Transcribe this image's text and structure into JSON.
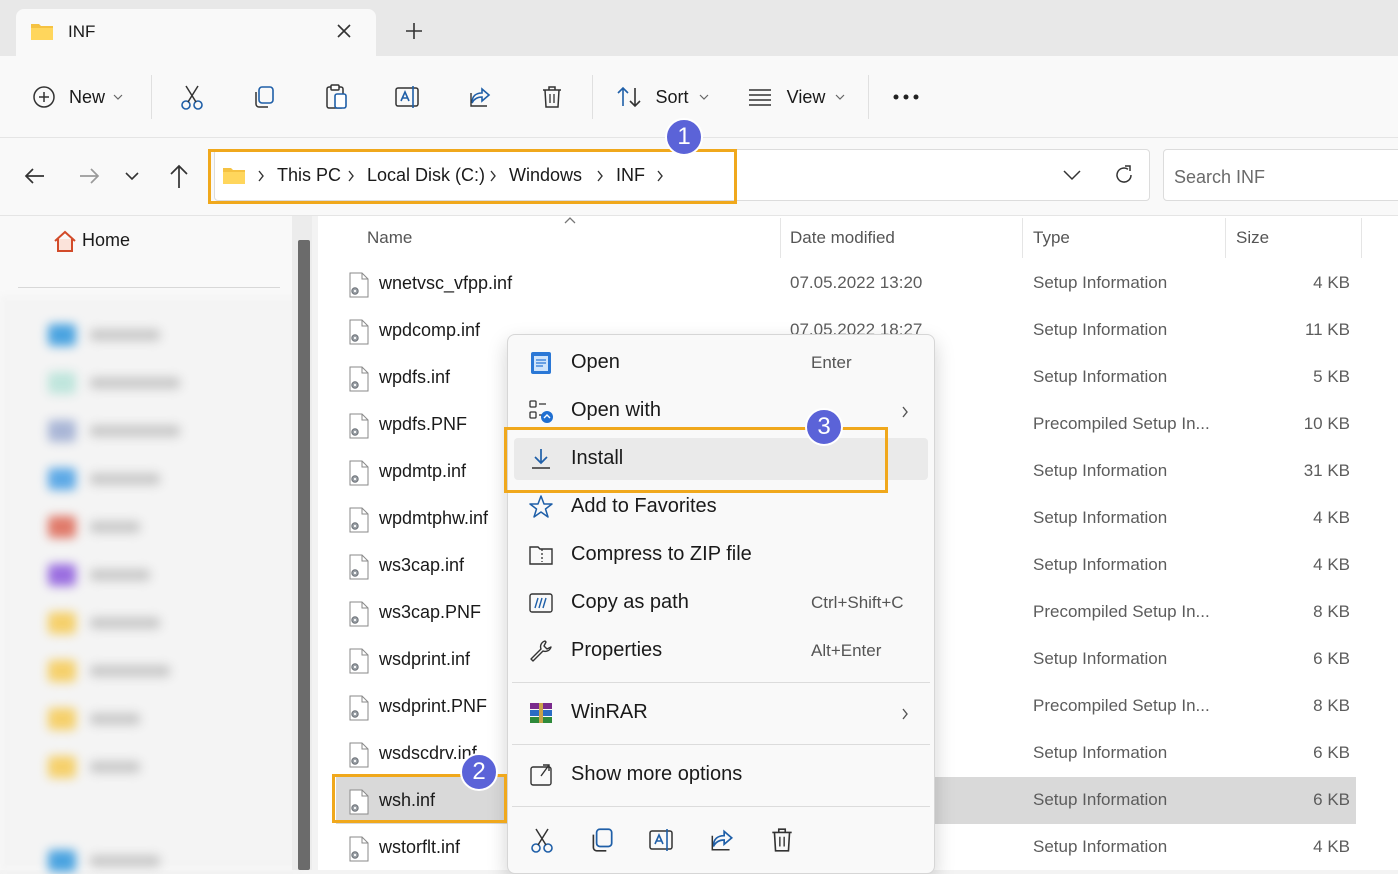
{
  "tab": {
    "title": "INF",
    "close_icon": "close-icon",
    "new_tab_icon": "plus-icon"
  },
  "command_bar": {
    "new_label": "New",
    "sort_label": "Sort",
    "view_label": "View",
    "icons": [
      "cut-icon",
      "copy-icon",
      "paste-icon",
      "rename-icon",
      "share-icon",
      "delete-icon",
      "more-icon"
    ]
  },
  "address": {
    "crumbs": [
      "This PC",
      "Local Disk (C:)",
      "Windows",
      "INF"
    ],
    "search_placeholder": "Search INF"
  },
  "sidebar": {
    "home_label": "Home"
  },
  "columns": {
    "name": "Name",
    "date": "Date modified",
    "type": "Type",
    "size": "Size"
  },
  "files": [
    {
      "name": "wnetvsc_vfpp.inf",
      "date": "07.05.2022 13:20",
      "type": "Setup Information",
      "size": "4 KB"
    },
    {
      "name": "wpdcomp.inf",
      "date": "07.05.2022 18:27",
      "type": "Setup Information",
      "size": "11 KB"
    },
    {
      "name": "wpdfs.inf",
      "date": "",
      "type": "Setup Information",
      "size": "5 KB"
    },
    {
      "name": "wpdfs.PNF",
      "date": "",
      "type": "Precompiled Setup In...",
      "size": "10 KB"
    },
    {
      "name": "wpdmtp.inf",
      "date": "",
      "type": "Setup Information",
      "size": "31 KB"
    },
    {
      "name": "wpdmtphw.inf",
      "date": "",
      "type": "Setup Information",
      "size": "4 KB"
    },
    {
      "name": "ws3cap.inf",
      "date": "",
      "type": "Setup Information",
      "size": "4 KB"
    },
    {
      "name": "ws3cap.PNF",
      "date": "",
      "type": "Precompiled Setup In...",
      "size": "8 KB"
    },
    {
      "name": "wsdprint.inf",
      "date": "",
      "type": "Setup Information",
      "size": "6 KB"
    },
    {
      "name": "wsdprint.PNF",
      "date": "",
      "type": "Precompiled Setup In...",
      "size": "8 KB"
    },
    {
      "name": "wsdscdrv.inf",
      "date": "",
      "type": "Setup Information",
      "size": "6 KB"
    },
    {
      "name": "wsh.inf",
      "date": "",
      "type": "Setup Information",
      "size": "6 KB"
    },
    {
      "name": "wstorflt.inf",
      "date": "",
      "type": "Setup Information",
      "size": "4 KB"
    }
  ],
  "context_menu": {
    "open": {
      "label": "Open",
      "shortcut": "Enter"
    },
    "open_with": {
      "label": "Open with"
    },
    "install": {
      "label": "Install"
    },
    "favorites": {
      "label": "Add to Favorites"
    },
    "zip": {
      "label": "Compress to ZIP file"
    },
    "copy_path": {
      "label": "Copy as path",
      "shortcut": "Ctrl+Shift+C"
    },
    "properties": {
      "label": "Properties",
      "shortcut": "Alt+Enter"
    },
    "winrar": {
      "label": "WinRAR"
    },
    "more": {
      "label": "Show more options"
    }
  },
  "badges": [
    "1",
    "2",
    "3"
  ],
  "colors": {
    "highlight": "#f0a81c",
    "badge": "#5b63d8",
    "accent": "#0067c0"
  }
}
